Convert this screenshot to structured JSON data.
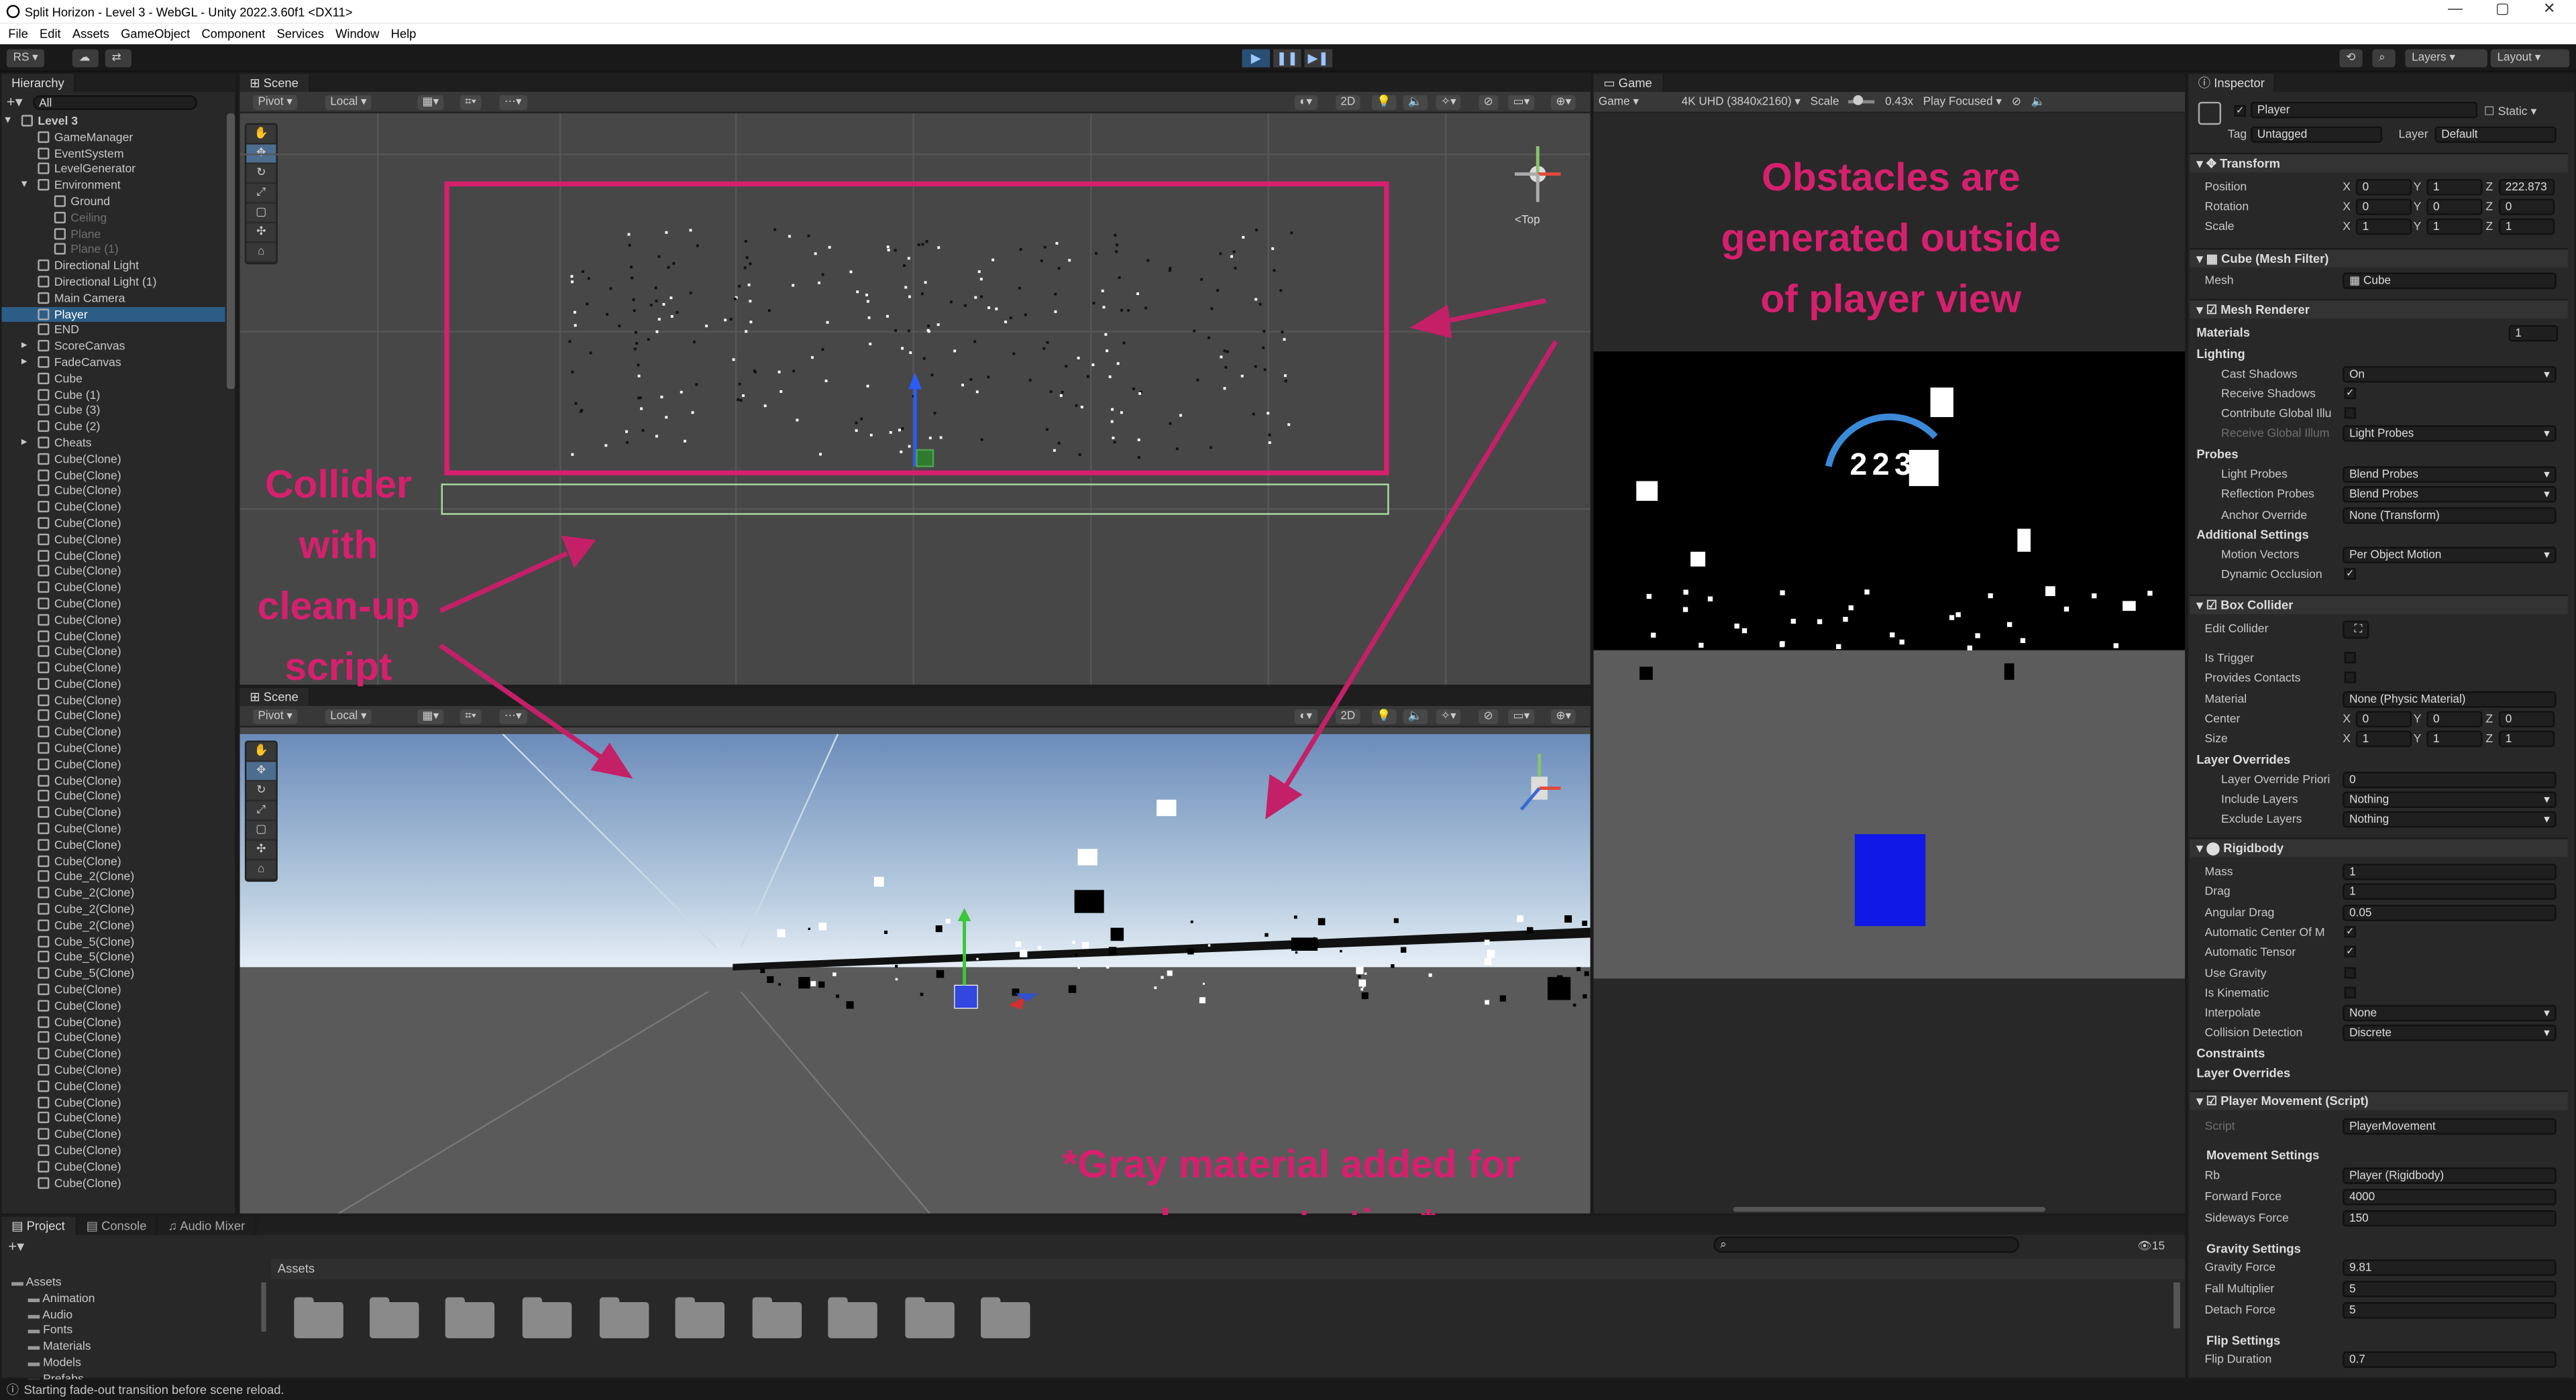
{
  "window": {
    "title": "Split Horizon - Level 3 - WebGL - Unity 2022.3.60f1 <DX11>",
    "minimize": "—",
    "maximize": "▢",
    "close": "✕"
  },
  "menu": [
    "File",
    "Edit",
    "Assets",
    "GameObject",
    "Component",
    "Services",
    "Window",
    "Help"
  ],
  "toolbar": {
    "account": "RS ▾",
    "layers": "Layers",
    "layout": "Layout",
    "play_icon": "play-icon",
    "pause_icon": "pause-icon",
    "step_icon": "step-icon"
  },
  "hierarchy": {
    "tab": "Hierarchy",
    "search_placeholder": "All",
    "items": [
      {
        "label": "Level 3",
        "indent": 0,
        "bold": true,
        "arrow": "▾"
      },
      {
        "label": "GameManager",
        "indent": 1
      },
      {
        "label": "EventSystem",
        "indent": 1
      },
      {
        "label": "LevelGenerator",
        "indent": 1
      },
      {
        "label": "Environment",
        "indent": 1,
        "arrow": "▾"
      },
      {
        "label": "Ground",
        "indent": 2
      },
      {
        "label": "Ceiling",
        "indent": 2,
        "dim": true
      },
      {
        "label": "Plane",
        "indent": 2,
        "dim": true
      },
      {
        "label": "Plane (1)",
        "indent": 2,
        "dim": true
      },
      {
        "label": "Directional Light",
        "indent": 1
      },
      {
        "label": "Directional Light (1)",
        "indent": 1
      },
      {
        "label": "Main Camera",
        "indent": 1
      },
      {
        "label": "Player",
        "indent": 1,
        "sel": true
      },
      {
        "label": "END",
        "indent": 1
      },
      {
        "label": "ScoreCanvas",
        "indent": 1,
        "arrow": "▸"
      },
      {
        "label": "FadeCanvas",
        "indent": 1,
        "arrow": "▸"
      },
      {
        "label": "Cube",
        "indent": 1
      },
      {
        "label": "Cube (1)",
        "indent": 1
      },
      {
        "label": "Cube (3)",
        "indent": 1
      },
      {
        "label": "Cube (2)",
        "indent": 1
      },
      {
        "label": "Cheats",
        "indent": 1,
        "arrow": "▸"
      },
      {
        "label": "Cube(Clone)",
        "indent": 1
      },
      {
        "label": "Cube(Clone)",
        "indent": 1
      },
      {
        "label": "Cube(Clone)",
        "indent": 1
      },
      {
        "label": "Cube(Clone)",
        "indent": 1
      },
      {
        "label": "Cube(Clone)",
        "indent": 1
      },
      {
        "label": "Cube(Clone)",
        "indent": 1
      },
      {
        "label": "Cube(Clone)",
        "indent": 1
      },
      {
        "label": "Cube(Clone)",
        "indent": 1
      },
      {
        "label": "Cube(Clone)",
        "indent": 1
      },
      {
        "label": "Cube(Clone)",
        "indent": 1
      },
      {
        "label": "Cube(Clone)",
        "indent": 1
      },
      {
        "label": "Cube(Clone)",
        "indent": 1
      },
      {
        "label": "Cube(Clone)",
        "indent": 1
      },
      {
        "label": "Cube(Clone)",
        "indent": 1
      },
      {
        "label": "Cube(Clone)",
        "indent": 1
      },
      {
        "label": "Cube(Clone)",
        "indent": 1
      },
      {
        "label": "Cube(Clone)",
        "indent": 1
      },
      {
        "label": "Cube(Clone)",
        "indent": 1
      },
      {
        "label": "Cube(Clone)",
        "indent": 1
      },
      {
        "label": "Cube(Clone)",
        "indent": 1
      },
      {
        "label": "Cube(Clone)",
        "indent": 1
      },
      {
        "label": "Cube(Clone)",
        "indent": 1
      },
      {
        "label": "Cube(Clone)",
        "indent": 1
      },
      {
        "label": "Cube(Clone)",
        "indent": 1
      },
      {
        "label": "Cube(Clone)",
        "indent": 1
      },
      {
        "label": "Cube(Clone)",
        "indent": 1
      },
      {
        "label": "Cube_2(Clone)",
        "indent": 1
      },
      {
        "label": "Cube_2(Clone)",
        "indent": 1
      },
      {
        "label": "Cube_2(Clone)",
        "indent": 1
      },
      {
        "label": "Cube_2(Clone)",
        "indent": 1
      },
      {
        "label": "Cube_5(Clone)",
        "indent": 1
      },
      {
        "label": "Cube_5(Clone)",
        "indent": 1
      },
      {
        "label": "Cube_5(Clone)",
        "indent": 1
      },
      {
        "label": "Cube(Clone)",
        "indent": 1
      },
      {
        "label": "Cube(Clone)",
        "indent": 1
      },
      {
        "label": "Cube(Clone)",
        "indent": 1
      },
      {
        "label": "Cube(Clone)",
        "indent": 1
      },
      {
        "label": "Cube(Clone)",
        "indent": 1
      },
      {
        "label": "Cube(Clone)",
        "indent": 1
      },
      {
        "label": "Cube(Clone)",
        "indent": 1
      },
      {
        "label": "Cube(Clone)",
        "indent": 1
      },
      {
        "label": "Cube(Clone)",
        "indent": 1
      },
      {
        "label": "Cube(Clone)",
        "indent": 1
      },
      {
        "label": "Cube(Clone)",
        "indent": 1
      },
      {
        "label": "Cube(Clone)",
        "indent": 1
      },
      {
        "label": "Cube(Clone)",
        "indent": 1
      }
    ]
  },
  "scene_top": {
    "tab": "Scene",
    "pivot": "Pivot",
    "local": "Local",
    "mode2d": "2D",
    "gizmo_label": "<Top"
  },
  "scene_bottom": {
    "tab": "Scene",
    "pivot": "Pivot",
    "local": "Local",
    "mode2d": "2D"
  },
  "game": {
    "tab": "Game",
    "display": "Game",
    "resolution": "4K UHD (3840x2160)",
    "scale_label": "Scale",
    "scale_value": "0.43x",
    "play_mode": "Play Focused",
    "score": "223"
  },
  "annotations": {
    "top_right": [
      "Obstacles are",
      "generated outside",
      "of player view"
    ],
    "left": [
      "Collider",
      "with",
      "clean-up",
      "script"
    ],
    "bottom": "*Gray material added for demonstration*"
  },
  "inspector": {
    "tab": "Inspector",
    "object": "Player",
    "static": "Static",
    "tag_label": "Tag",
    "tag": "Untagged",
    "layer_label": "Layer",
    "layer": "Default",
    "transform": {
      "title": "Transform",
      "position": [
        "0",
        "1",
        "222.873"
      ],
      "rotation": [
        "0",
        "0",
        "0"
      ],
      "scale": [
        "1",
        "1",
        "1"
      ],
      "labels": [
        "Position",
        "Rotation",
        "Scale"
      ]
    },
    "mesh_filter": {
      "title": "Cube (Mesh Filter)",
      "mesh_label": "Mesh",
      "mesh": "Cube"
    },
    "mesh_renderer": {
      "title": "Mesh Renderer",
      "materials": "Materials",
      "materials_count": "1",
      "lighting": "Lighting",
      "cast_shadows_label": "Cast Shadows",
      "cast_shadows": "On",
      "receive_shadows": "Receive Shadows",
      "contribute_gi": "Contribute Global Illu",
      "receive_gi": "Receive Global Illum",
      "receive_gi_value": "Light Probes",
      "probes": "Probes",
      "light_probes_label": "Light Probes",
      "light_probes": "Blend Probes",
      "reflection_probes_label": "Reflection Probes",
      "reflection_probes": "Blend Probes",
      "anchor_override_label": "Anchor Override",
      "anchor_override": "None (Transform)",
      "additional": "Additional Settings",
      "motion_vectors_label": "Motion Vectors",
      "motion_vectors": "Per Object Motion",
      "dynamic_occlusion": "Dynamic Occlusion"
    },
    "box_collider": {
      "title": "Box Collider",
      "edit_collider": "Edit Collider",
      "is_trigger": "Is Trigger",
      "provides_contacts": "Provides Contacts",
      "material_label": "Material",
      "material": "None (Physic Material)",
      "center_label": "Center",
      "center": [
        "0",
        "0",
        "0"
      ],
      "size_label": "Size",
      "size": [
        "1",
        "1",
        "1"
      ],
      "layer_overrides": "Layer Overrides",
      "lop_label": "Layer Override Priori",
      "lop": "0",
      "include_label": "Include Layers",
      "include": "Nothing",
      "exclude_label": "Exclude Layers",
      "exclude": "Nothing"
    },
    "rigidbody": {
      "title": "Rigidbody",
      "mass_label": "Mass",
      "mass": "1",
      "drag_label": "Drag",
      "drag": "1",
      "angular_drag_label": "Angular Drag",
      "angular_drag": "0.05",
      "auto_com": "Automatic Center Of M",
      "auto_tensor": "Automatic Tensor",
      "use_gravity": "Use Gravity",
      "is_kinematic": "Is Kinematic",
      "interpolate_label": "Interpolate",
      "interpolate": "None",
      "collision_label": "Collision Detection",
      "collision": "Discrete",
      "constraints": "Constraints",
      "layer_overrides": "Layer Overrides"
    },
    "player_movement": {
      "title": "Player Movement (Script)",
      "script_label": "Script",
      "script": "PlayerMovement",
      "movement_settings": "Movement Settings",
      "rb_label": "Rb",
      "rb": "Player (Rigidbody)",
      "forward_label": "Forward Force",
      "forward": "4000",
      "sideways_label": "Sideways Force",
      "sideways": "150",
      "gravity_settings": "Gravity Settings",
      "gravity_force_label": "Gravity Force",
      "gravity_force": "9.81",
      "fall_label": "Fall Multiplier",
      "fall": "5",
      "detach_label": "Detach Force",
      "detach": "5",
      "flip_settings": "Flip Settings",
      "flip_duration_label": "Flip Duration",
      "flip_duration": "0.7"
    }
  },
  "project": {
    "tabs": [
      "Project",
      "Console",
      "Audio Mixer"
    ],
    "breadcrumb": "Assets",
    "count": "15",
    "tree": [
      "Assets",
      "Animation",
      "Audio",
      "Fonts",
      "Materials",
      "Models",
      "Prefabs"
    ]
  },
  "status": {
    "message": "Starting fade-out transition before scene reload."
  }
}
